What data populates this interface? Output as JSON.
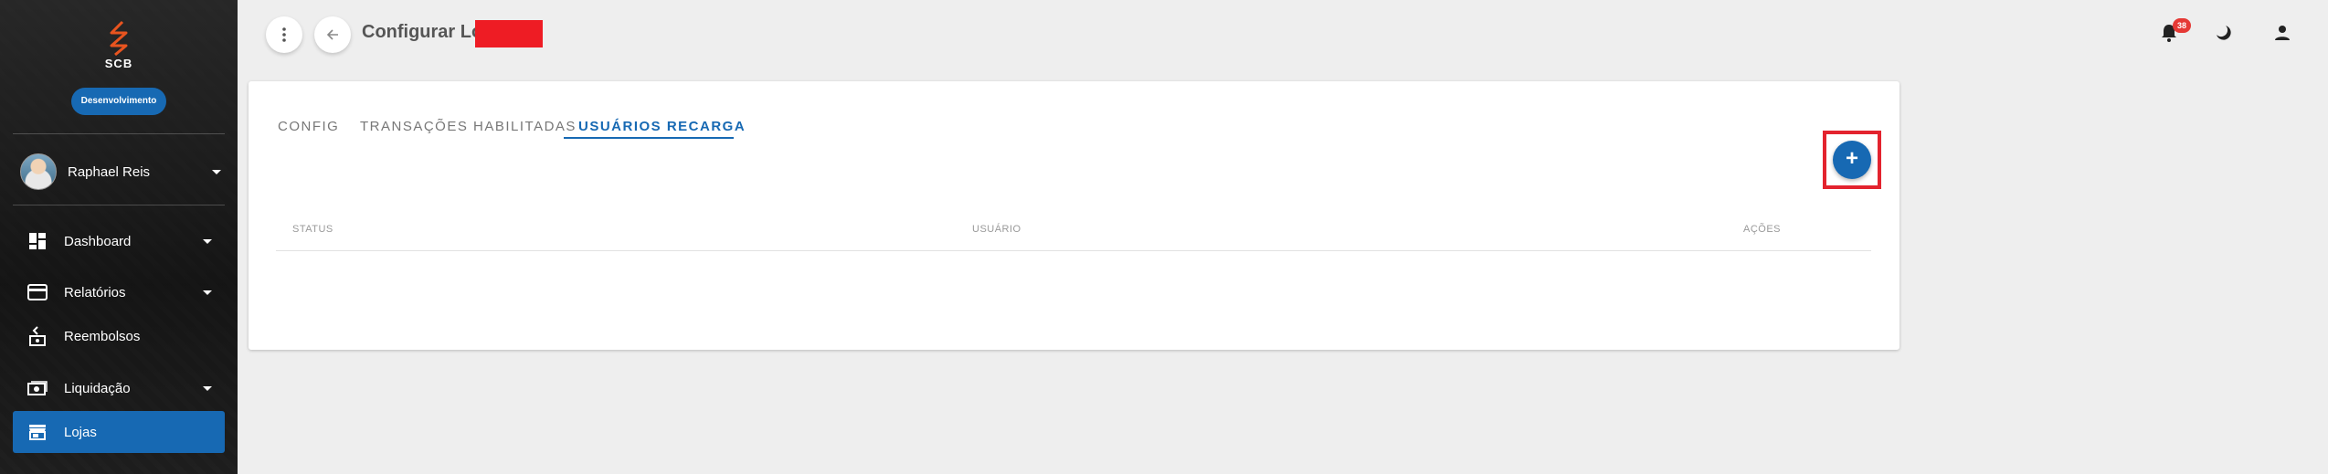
{
  "colors": {
    "accent": "#1769b3",
    "sidebar_bg": "#1d1d1d",
    "page_bg": "#eeeeee",
    "highlight": "#e3232e",
    "notification": "#e53935"
  },
  "sidebar": {
    "logo_text": "SCB",
    "environment_badge": "Desenvolvimento",
    "user": {
      "name": "Raphael Reis",
      "avatar_icon": "user-avatar"
    },
    "items": [
      {
        "label": "Dashboard",
        "icon": "dashboard-icon",
        "has_submenu": true
      },
      {
        "label": "Relatórios",
        "icon": "credit-card-icon",
        "has_submenu": true
      },
      {
        "label": "Reembolsos",
        "icon": "refund-icon",
        "has_submenu": false
      },
      {
        "label": "Liquidação",
        "icon": "cash-icon",
        "has_submenu": true
      },
      {
        "label": "Lojas",
        "icon": "store-icon",
        "has_submenu": false,
        "active": true
      }
    ]
  },
  "header": {
    "menu_icon": "more-vert-icon",
    "back_icon": "arrow-back-icon",
    "title": "Configurar Loja",
    "notifications_count": "38",
    "notifications_icon": "bell-icon",
    "theme_icon": "moon-icon",
    "account_icon": "person-icon"
  },
  "tabs": [
    {
      "label": "CONFIG",
      "active": false
    },
    {
      "label": "TRANSAÇÕES HABILITADAS",
      "active": false
    },
    {
      "label": "USUÁRIOS RECARGA",
      "active": true
    }
  ],
  "add_button": {
    "label": "+",
    "icon": "plus-icon"
  },
  "table": {
    "columns": [
      "STATUS",
      "USUÁRIO",
      "AÇÕES"
    ],
    "rows": []
  }
}
